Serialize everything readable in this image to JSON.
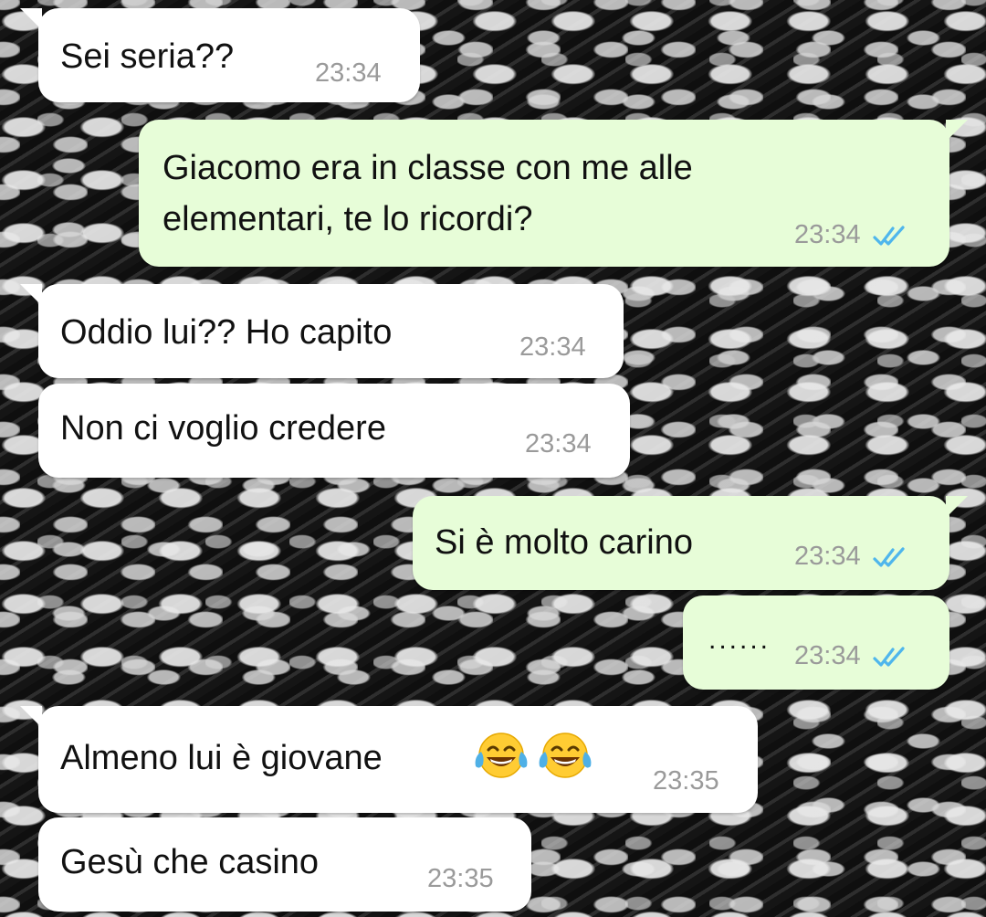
{
  "messages": [
    {
      "direction": "incoming",
      "text": "Sei seria??",
      "time": "23:34"
    },
    {
      "direction": "outgoing",
      "lines": [
        "Giacomo era in classe con me alle",
        "elementari, te lo ricordi?"
      ],
      "time": "23:34",
      "status": "read"
    },
    {
      "direction": "incoming",
      "text": "Oddio lui?? Ho capito",
      "time": "23:34"
    },
    {
      "direction": "incoming",
      "text": "Non ci voglio credere",
      "time": "23:34"
    },
    {
      "direction": "outgoing",
      "text": "Si è molto carino",
      "time": "23:34",
      "status": "read"
    },
    {
      "direction": "outgoing",
      "text": "......",
      "time": "23:34",
      "status": "read"
    },
    {
      "direction": "incoming",
      "text": "Almeno lui è giovane",
      "emojis": [
        "face-with-tears-of-joy",
        "face-with-tears-of-joy"
      ],
      "time": "23:35"
    },
    {
      "direction": "incoming",
      "text": "Gesù che casino",
      "time": "23:35"
    }
  ],
  "colors": {
    "incoming_bubble": "#ffffff",
    "outgoing_bubble": "#e7fdd8",
    "timestamp": "#9a9a9a",
    "read_ticks": "#4fb6ec"
  },
  "icons": {
    "read_receipt": "double-check-icon",
    "emoji": "face-with-tears-of-joy-icon"
  }
}
